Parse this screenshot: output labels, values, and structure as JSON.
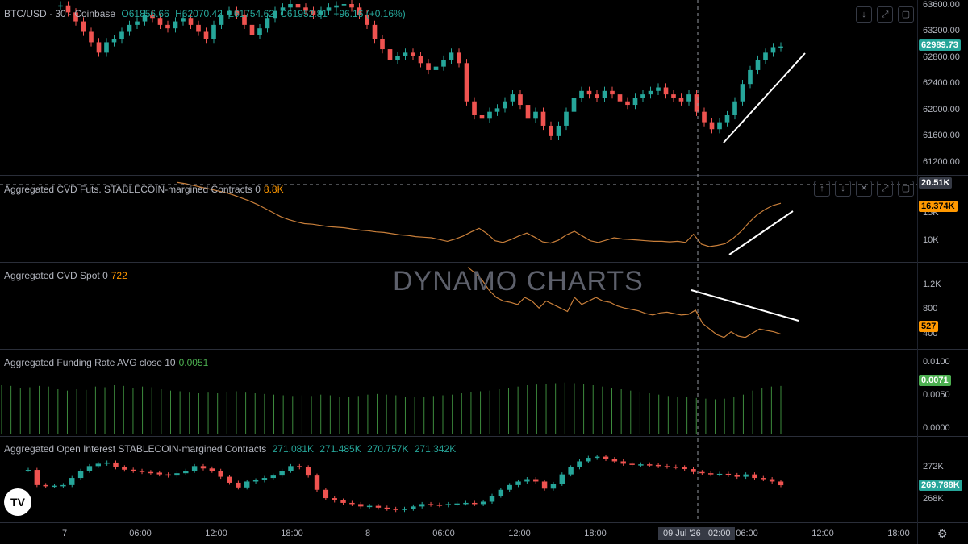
{
  "header": {
    "symbol": "BTC/USD · 30 · Coinbase",
    "open": "O61856.66",
    "high": "H62070.42",
    "low": "L61754.62",
    "close": "C61952.81",
    "change": "+96.16 (+0.16%)"
  },
  "watermark": "DYNAMO CHARTS",
  "crosshair_date": "09 Jul '26",
  "crosshair_time": "02:00",
  "logo_text": "TV",
  "gear_icon": "gear-icon",
  "colors": {
    "up": "#26a69a",
    "down": "#ef5350",
    "cvd": "#c97f3a",
    "funding": "#3d8b3d",
    "funding_badge": "#4caf50",
    "badge": "#ff9800"
  },
  "panes": {
    "price": {
      "ticks": [
        "63600.00",
        "63200.00",
        "62800.00",
        "62400.00",
        "62000.00",
        "61600.00",
        "61200.00"
      ],
      "last_price": "62989.73",
      "crosshair_value": "20.51K"
    },
    "cvd_futs": {
      "title": "Aggregated CVD Futs. STABLECOIN-margined Contracts 0",
      "value": "8.8K",
      "ticks": [
        "15K",
        "10K"
      ],
      "last": "16.374K"
    },
    "cvd_spot": {
      "title": "Aggregated CVD Spot 0",
      "value": "722",
      "ticks": [
        "1.2K",
        "800",
        "400"
      ],
      "last": "527"
    },
    "funding": {
      "title": "Aggregated Funding Rate AVG close 10",
      "value": "0.0051",
      "ticks": [
        "0.0100",
        "0.0050",
        "0.0000"
      ],
      "last": "0.0071"
    },
    "oi": {
      "title": "Aggregated Open Interest STABLECOIN-margined Contracts",
      "values": [
        "271.081K",
        "271.485K",
        "270.757K",
        "271.342K"
      ],
      "ticks": [
        "272K",
        "268K"
      ],
      "last": "269.788K"
    }
  },
  "x_axis": {
    "labels": [
      "7",
      "06:00",
      "12:00",
      "18:00",
      "8",
      "06:00",
      "12:00",
      "18:00",
      "06:00",
      "12:00",
      "18:00"
    ]
  },
  "chart_data": [
    {
      "type": "candlestick",
      "ylim": [
        61200,
        63600
      ],
      "x_step": "30m",
      "close": [
        63580,
        63480,
        63350,
        63200,
        63050,
        62900,
        63050,
        63100,
        63200,
        63300,
        63350,
        63450,
        63400,
        63300,
        63250,
        63350,
        63400,
        63300,
        63200,
        63100,
        63300,
        63450,
        63500,
        63450,
        63300,
        63150,
        63250,
        63400,
        63500,
        63550,
        63600,
        63550,
        63500,
        63450,
        63500,
        63550,
        63580,
        63600,
        63550,
        63450,
        63300,
        63100,
        62950,
        62800,
        62850,
        62900,
        62850,
        62750,
        62650,
        62700,
        62800,
        62900,
        62750,
        62200,
        62000,
        61950,
        62050,
        62100,
        62200,
        62300,
        62150,
        61950,
        62050,
        61850,
        61700,
        61850,
        62050,
        62250,
        62350,
        62300,
        62250,
        62350,
        62300,
        62200,
        62150,
        62250,
        62300,
        62350,
        62400,
        62300,
        62250,
        62200,
        62300,
        62050,
        61900,
        61800,
        61900,
        62000,
        62200,
        62450,
        62650,
        62800,
        62900,
        62980,
        62990
      ]
    },
    {
      "type": "line",
      "name": "Aggregated CVD Futs. STABLECOIN-margined Contracts 0",
      "ylim": [
        6800,
        20510
      ],
      "values": [
        19900,
        19700,
        19400,
        19100,
        18800,
        18500,
        18200,
        17800,
        17300,
        16800,
        16200,
        15500,
        14800,
        14100,
        13600,
        13200,
        12900,
        12800,
        12600,
        12400,
        12300,
        12200,
        12000,
        11800,
        11700,
        11500,
        11400,
        11200,
        11000,
        10900,
        10700,
        10600,
        10500,
        10200,
        9900,
        10300,
        10800,
        11500,
        12100,
        11200,
        10000,
        9700,
        10200,
        10800,
        11300,
        10600,
        9800,
        9600,
        10100,
        11000,
        11600,
        10800,
        10000,
        9700,
        10100,
        10500,
        10300,
        10200,
        10100,
        10000,
        9900,
        9900,
        9800,
        9900,
        9700,
        11100,
        9400,
        9000,
        9200,
        9500,
        10400,
        11600,
        13100,
        14400,
        15300,
        16000,
        16374
      ]
    },
    {
      "type": "line",
      "name": "Aggregated CVD Spot 0",
      "ylim": [
        350,
        1500
      ],
      "values": [
        1480,
        1400,
        1300,
        1150,
        1050,
        1000,
        980,
        950,
        1050,
        1000,
        900,
        1000,
        950,
        900,
        850,
        1050,
        950,
        1000,
        1050,
        1000,
        980,
        930,
        900,
        880,
        860,
        820,
        800,
        830,
        840,
        820,
        800,
        810,
        870,
        680,
        600,
        520,
        480,
        560,
        500,
        480,
        540,
        600,
        580,
        560,
        527
      ]
    },
    {
      "type": "bar",
      "name": "Aggregated Funding Rate AVG close 10",
      "ylim": [
        0,
        0.012
      ],
      "values": [
        0.0072,
        0.0071,
        0.0068,
        0.0069,
        0.0071,
        0.007,
        0.0066,
        0.0064,
        0.0066,
        0.0065,
        0.007,
        0.0069,
        0.0072,
        0.0071,
        0.0068,
        0.007,
        0.0069,
        0.0066,
        0.0064,
        0.0063,
        0.0061,
        0.006,
        0.0061,
        0.006,
        0.0062,
        0.0063,
        0.0061,
        0.006,
        0.0059,
        0.0058,
        0.0057,
        0.0056,
        0.0057,
        0.0056,
        0.0058,
        0.0057,
        0.0055,
        0.0054,
        0.0056,
        0.0058,
        0.0059,
        0.0058,
        0.0057,
        0.0055,
        0.0054,
        0.0055,
        0.0056,
        0.0057,
        0.0058,
        0.006,
        0.0062,
        0.0063,
        0.0064,
        0.0066,
        0.0068,
        0.007,
        0.0072,
        0.0073,
        0.0074,
        0.0075,
        0.0076,
        0.0075,
        0.0074,
        0.0072,
        0.007,
        0.0068,
        0.0066,
        0.0064,
        0.0062,
        0.006,
        0.0058,
        0.0056,
        0.0055,
        0.0054,
        0.0053,
        0.0052,
        0.0051,
        0.0052,
        0.0054,
        0.0058,
        0.0064,
        0.0068,
        0.007,
        0.0071
      ]
    },
    {
      "type": "candlestick",
      "name": "Aggregated Open Interest STABLECOIN-margined Contracts",
      "ylim": [
        266800,
        273600
      ],
      "close": [
        271081,
        269800,
        269700,
        269750,
        269800,
        270400,
        271000,
        271400,
        271600,
        271700,
        271300,
        271100,
        271000,
        270900,
        270850,
        270700,
        270600,
        270800,
        271000,
        271400,
        271200,
        271000,
        270500,
        270000,
        269600,
        270100,
        270200,
        270400,
        270600,
        271000,
        271400,
        271300,
        270600,
        269400,
        268700,
        268500,
        268300,
        268200,
        268000,
        268050,
        267900,
        267800,
        267700,
        267800,
        268000,
        268200,
        268150,
        268100,
        268200,
        268250,
        268300,
        268200,
        268400,
        268900,
        269400,
        269800,
        270100,
        270300,
        270100,
        269500,
        269900,
        270700,
        271300,
        271800,
        272100,
        272200,
        272000,
        271800,
        271600,
        271500,
        271550,
        271500,
        271400,
        271350,
        271300,
        271150,
        270900,
        270800,
        270700,
        270750,
        270650,
        270500,
        270700,
        270400,
        270300,
        270100,
        269788
      ]
    }
  ]
}
